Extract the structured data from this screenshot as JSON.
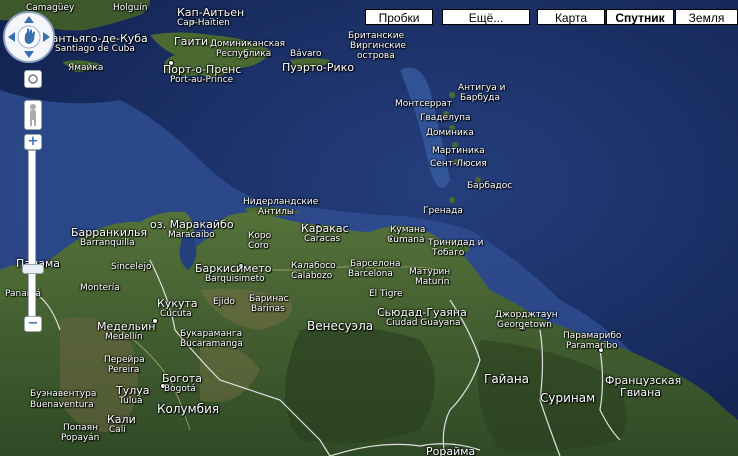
{
  "map_types": {
    "traffic": "Пробки",
    "more": "Ещё...",
    "map": "Карта",
    "satellite": "Спутник",
    "terrain": "Земля",
    "active": "Спутник"
  },
  "controls": {
    "zoom_in": "+",
    "zoom_out": "−",
    "zoom_level": "Стрит-вью"
  },
  "labels": {
    "camaguey": "Camagüey",
    "holguin": "Holguín",
    "santiago": "Сантьяго-де-Куба",
    "santiago_sub": "Santiago de Cuba",
    "cap_haitien": "Кап-Аитьен",
    "cap_haitien_sub": "Cap-Haïtien",
    "haiti": "Гаити",
    "dominican": "Доминиканская",
    "republic": "Республика",
    "jamaica": "Ямайка",
    "port_au_prince": "Порт-о-Пренс",
    "port_au_prince_sub": "Port-au-Prince",
    "bavaro": "Bávaro",
    "puerto_rico": "Пуэрто-Рико",
    "bvi1": "Британские",
    "bvi2": "Виргинские",
    "bvi3": "острова",
    "antigua1": "Антигуа и",
    "antigua2": "Барбуда",
    "montserrat": "Монтсеррат",
    "guadeloupe": "Гваделупа",
    "dominica": "Доминика",
    "martinique": "Мартиника",
    "st_lucia": "Сент-Люсия",
    "barbados": "Барбадос",
    "grenada": "Гренада",
    "antilles1": "Нидерландские",
    "antilles2": "Антилы",
    "maracaibo_lake": "оз. Маракайбо",
    "maracaibo_sub": "Maracaibo",
    "barranquilla": "Барранкилья",
    "barranquilla_sub": "Barranquilla",
    "coro": "Коро",
    "coro_sub": "Coro",
    "caracas": "Каракас",
    "caracas_sub": "Caracas",
    "cumana": "Кумана",
    "cumana_sub": "Cumaná",
    "trinidad1": "Тринидад и",
    "trinidad2": "Тобаго",
    "sincelejo": "Sincelejo",
    "panama": "Панама",
    "panama_sub": "Panamá",
    "montería": "Montería",
    "barquisimeto": "Баркисимето",
    "barquisimeto_sub": "Barquisimeto",
    "calabozo": "Калабосо",
    "calabozo_sub": "Calabozo",
    "barcelona": "Барселона",
    "barcelona_sub": "Barcelona",
    "maturin": "Матурин",
    "maturin_sub": "Maturín",
    "el_tigre": "El Tigre",
    "ejido": "Ejido",
    "barinas": "Баринас",
    "barinas_sub": "Barinas",
    "cucuta": "Кукута",
    "cucuta_sub": "Cúcuta",
    "venezuela": "Венесуэла",
    "ciudad_guayana": "Сьюдад-Гуаяна",
    "ciudad_guayana_sub": "Ciudad Guayana",
    "georgetown": "Джорджтаун",
    "georgetown_sub": "Georgetown",
    "paramaribo": "Парамарибо",
    "paramaribo_sub": "Paramaribo",
    "medellin": "Медельин",
    "medellin_sub": "Medellín",
    "bucaramanga": "Букараманга",
    "bucaramanga_sub": "Bucaramanga",
    "pereira": "Перейра",
    "pereira_sub": "Pereira",
    "tulua": "Тулуа",
    "tulua_sub": "Tuluá",
    "bogota": "Богота",
    "bogota_sub": "Bogotá",
    "colombia": "Колумбия",
    "buenaventura": "Буэнавентура",
    "buenaventura_sub": "Buenaventura",
    "cali": "Кали",
    "cali_sub": "Cali",
    "popayan": "Попаян",
    "popayan_sub": "Popayán",
    "guyana": "Гайана",
    "suriname": "Суринам",
    "french_guiana1": "Французская",
    "french_guiana2": "Гвиана",
    "roraima": "Рорайма"
  },
  "colors": {
    "ocean_deep": "#0f1f4a",
    "ocean": "#1d3a78",
    "shelf": "#3b63a8",
    "land_green": "#3d5a2c",
    "land_dark": "#2b4020",
    "land_brown": "#6b6640",
    "border": "#d8d8d8"
  }
}
